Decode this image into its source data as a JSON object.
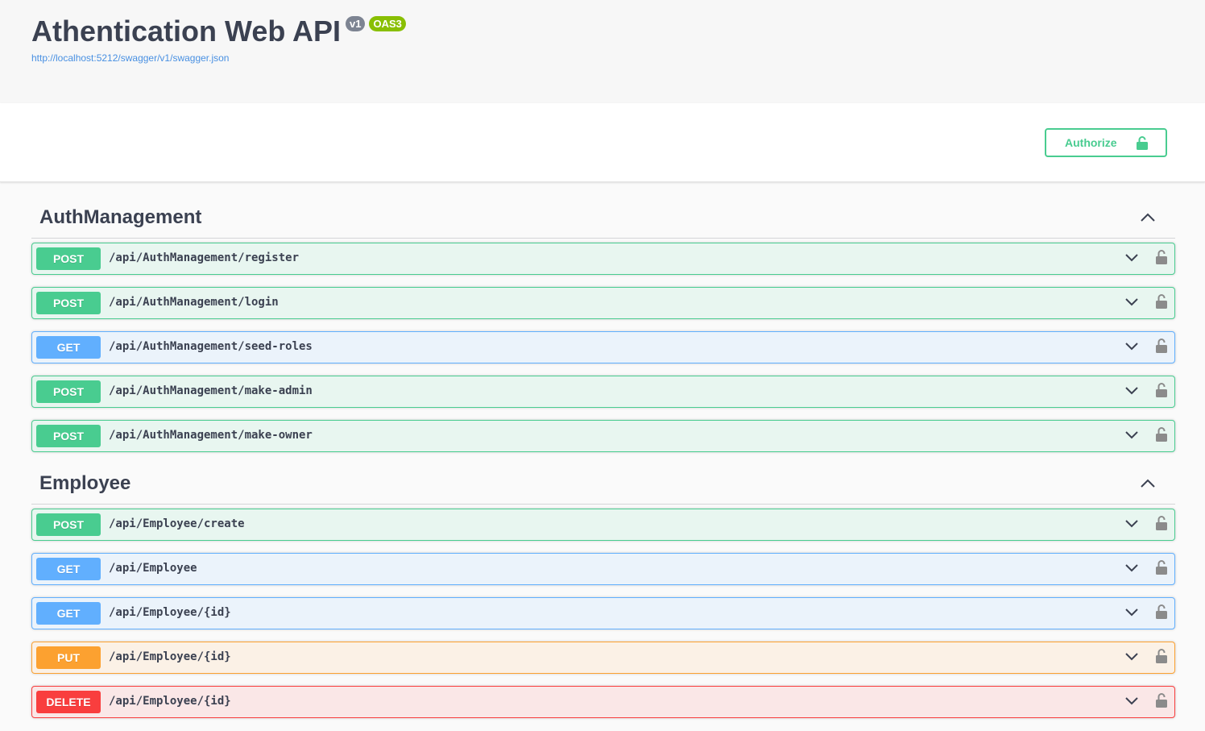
{
  "info": {
    "title": "Athentication Web API",
    "version_badge": "v1",
    "oas_badge": "OAS3",
    "spec_url": "http://localhost:5212/swagger/v1/swagger.json"
  },
  "authorize": {
    "label": "Authorize",
    "icon": "lock-icon"
  },
  "colors": {
    "post": "#49cc90",
    "get": "#61affe",
    "put": "#fca130",
    "delete": "#f93e3e"
  },
  "tags": [
    {
      "name": "AuthManagement",
      "operations": [
        {
          "method": "POST",
          "path": "/api/AuthManagement/register"
        },
        {
          "method": "POST",
          "path": "/api/AuthManagement/login"
        },
        {
          "method": "GET",
          "path": "/api/AuthManagement/seed-roles"
        },
        {
          "method": "POST",
          "path": "/api/AuthManagement/make-admin"
        },
        {
          "method": "POST",
          "path": "/api/AuthManagement/make-owner"
        }
      ]
    },
    {
      "name": "Employee",
      "operations": [
        {
          "method": "POST",
          "path": "/api/Employee/create"
        },
        {
          "method": "GET",
          "path": "/api/Employee"
        },
        {
          "method": "GET",
          "path": "/api/Employee/{id}"
        },
        {
          "method": "PUT",
          "path": "/api/Employee/{id}"
        },
        {
          "method": "DELETE",
          "path": "/api/Employee/{id}"
        }
      ]
    }
  ]
}
